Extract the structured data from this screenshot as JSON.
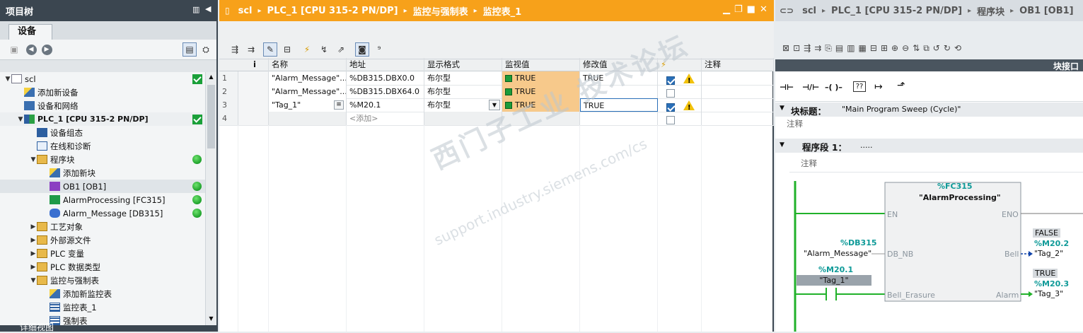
{
  "left": {
    "title": "项目树",
    "tab": "设备",
    "tree": [
      {
        "label": "scl",
        "status": "check"
      },
      {
        "label": "添加新设备",
        "status": ""
      },
      {
        "label": "设备和网络",
        "status": ""
      },
      {
        "label": "PLC_1 [CPU 315-2 PN/DP]",
        "status": "check"
      },
      {
        "label": "设备组态",
        "status": ""
      },
      {
        "label": "在线和诊断",
        "status": ""
      },
      {
        "label": "程序块",
        "status": "dot"
      },
      {
        "label": "添加新块",
        "status": ""
      },
      {
        "label": "OB1 [OB1]",
        "status": "dot"
      },
      {
        "label": "AlarmProcessing [FC315]",
        "status": "dot"
      },
      {
        "label": "Alarm_Message [DB315]",
        "status": "dot"
      },
      {
        "label": "工艺对象",
        "status": ""
      },
      {
        "label": "外部源文件",
        "status": ""
      },
      {
        "label": "PLC 变量",
        "status": ""
      },
      {
        "label": "PLC 数据类型",
        "status": ""
      },
      {
        "label": "监控与强制表",
        "status": ""
      },
      {
        "label": "添加新监控表",
        "status": ""
      },
      {
        "label": "监控表_1",
        "status": ""
      },
      {
        "label": "强制表",
        "status": ""
      }
    ],
    "footer": "详细视图"
  },
  "middle": {
    "breadcrumb": [
      "scl",
      "PLC_1 [CPU 315-2 PN/DP]",
      "监控与强制表",
      "监控表_1"
    ],
    "columns": [
      "i",
      "名称",
      "地址",
      "显示格式",
      "监视值",
      "修改值",
      "⚡",
      "注释"
    ],
    "rows": [
      {
        "num": "1",
        "name": "\"Alarm_Message\"...",
        "addr": "%DB315.DBX0.0",
        "fmt": "布尔型",
        "monitor": "TRUE",
        "modify": "TRUE",
        "checked": true,
        "warn": true
      },
      {
        "num": "2",
        "name": "\"Alarm_Message\"...",
        "addr": "%DB315.DBX64.0",
        "fmt": "布尔型",
        "monitor": "TRUE",
        "modify": "",
        "checked": false,
        "warn": false
      },
      {
        "num": "3",
        "name": "\"Tag_1\"",
        "addr": "%M20.1",
        "fmt": "布尔型",
        "monitor": "TRUE",
        "modify": "TRUE",
        "checked": true,
        "warn": true
      },
      {
        "num": "4",
        "name": "",
        "addr": "<添加>",
        "fmt": "",
        "monitor": "",
        "modify": "",
        "checked": false,
        "warn": false
      }
    ],
    "watermark": "西门子工业 技术论坛",
    "watermark_url": "support.industry.siemens.com/cs"
  },
  "right": {
    "breadcrumb": [
      "scl",
      "PLC_1 [CPU 315-2 PN/DP]",
      "程序块",
      "OB1 [OB1]"
    ],
    "interface_label": "块接口",
    "block_title_label": "块标题：",
    "block_title": "\"Main Program Sweep (Cycle)\"",
    "comment": "注释",
    "network_label": "程序段 1：",
    "network_title": ".....",
    "network_comment": "注释",
    "fc_addr": "%FC315",
    "fc_name": "\"AlarmProcessing\"",
    "pin_en": "EN",
    "pin_eno": "ENO",
    "pin_dbnb": "DB_NB",
    "pin_bell": "Bell",
    "pin_erasure": "Bell_Erasure",
    "pin_alarm": "Alarm",
    "db_addr": "%DB315",
    "db_name": "\"Alarm_Message\"",
    "tag1_addr": "%M20.1",
    "tag1_name": "\"Tag_1\"",
    "bell_value": "FALSE",
    "bell_addr": "%M20.2",
    "bell_name": "\"Tag_2\"",
    "alarm_value": "TRUE",
    "alarm_addr": "%M20.3",
    "alarm_name": "\"Tag_3\""
  }
}
